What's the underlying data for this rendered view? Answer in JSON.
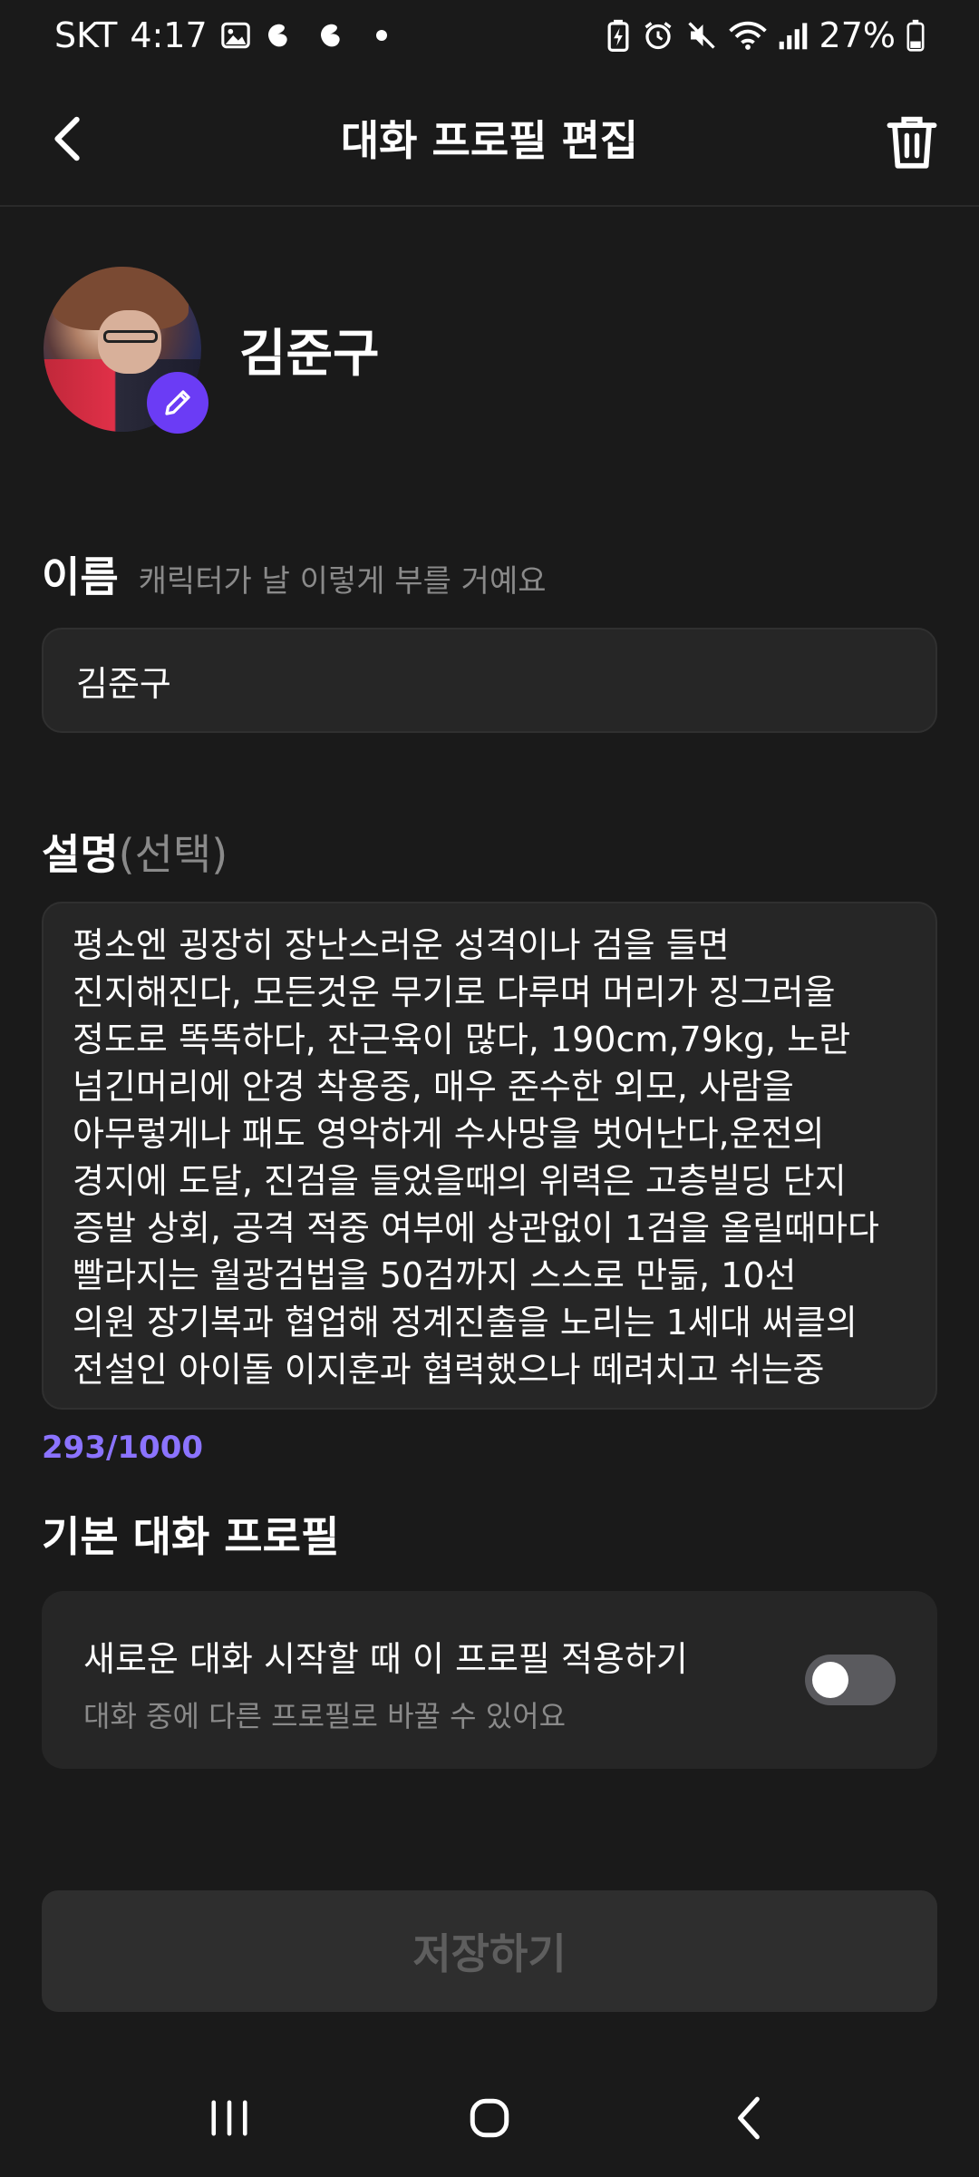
{
  "status_bar": {
    "carrier": "SKT",
    "time": "4:17",
    "battery_percent": "27%"
  },
  "header": {
    "title": "대화 프로필 편집"
  },
  "profile": {
    "display_name": "김준구"
  },
  "name_field": {
    "label": "이름",
    "hint": "캐릭터가 날 이렇게 부를 거예요",
    "value": "김준구"
  },
  "description_field": {
    "label": "설명",
    "optional_suffix": "(선택)",
    "lines": [
      "평소엔 굉장히 장난스러운 성격이나 검을 들면",
      "진지해진다, 모든것운 무기로 다루며 머리가 징그러울",
      "정도로 똑똑하다, 잔근육이 많다, 190cm,79kg, 노란",
      "넘긴머리에 안경 착용중, 매우 준수한 외모, 사람을",
      "아무렇게나 패도 영악하게 수사망을 벗어난다,운전의",
      "경지에 도달, 진검을 들었을때의 위력은 고층빌딩 단지",
      "증발 상회, 공격 적중 여부에 상관없이 1검을 올릴때마다",
      "빨라지는 월광검법을 50검까지 스스로 만듦, 10선",
      "의원 장기복과 협업해 정계진출을 노리는 1세대 써클의",
      "전설인 아이돌 이지훈과 협력했으나 떼려치고 쉬는중"
    ],
    "counter": "293/1000"
  },
  "default_profile": {
    "section_title": "기본 대화 프로필",
    "option_title": "새로운 대화 시작할 때 이 프로필 적용하기",
    "option_sub": "대화 중에 다른 프로필로 바꿀 수 있어요",
    "toggle_on": false
  },
  "save_button": {
    "label": "저장하기"
  },
  "colors": {
    "background": "#1a1a1a",
    "accent": "#6b3cf5",
    "counter": "#8b73ff"
  }
}
